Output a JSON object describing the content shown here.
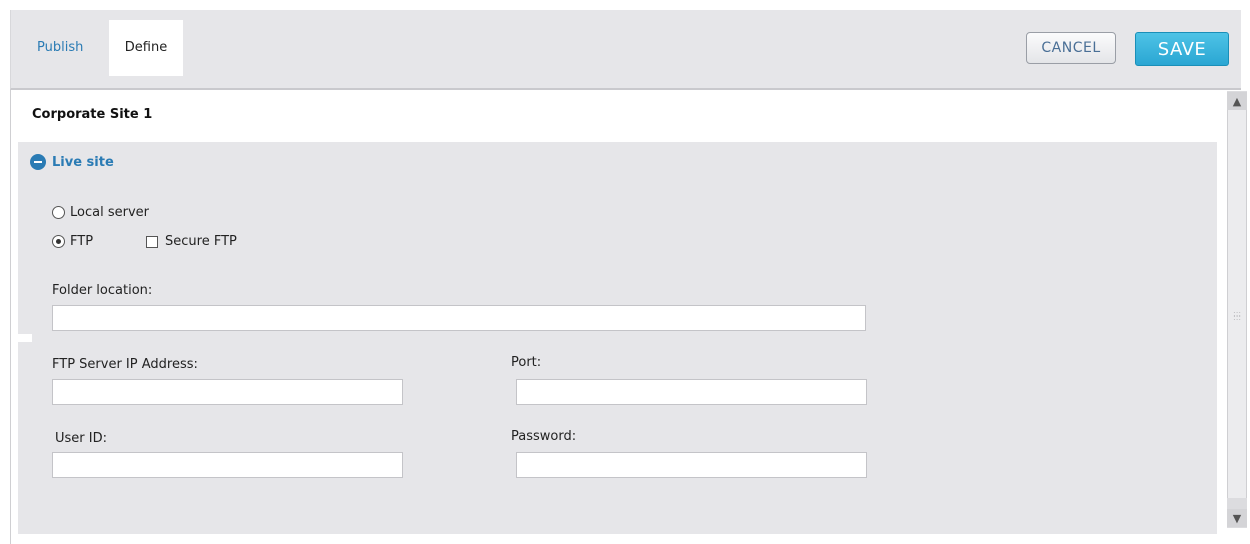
{
  "tabs": {
    "publish": "Publish",
    "define": "Define"
  },
  "buttons": {
    "cancel": "CANCEL",
    "save": "SAVE"
  },
  "site": {
    "title": "Corporate Site 1"
  },
  "section": {
    "title": "Live site",
    "options": {
      "local_server": "Local server",
      "ftp": "FTP",
      "secure_ftp": "Secure FTP",
      "selected": "FTP",
      "secure_ftp_checked": false
    },
    "fields": {
      "folder_location": {
        "label": "Folder location:",
        "value": ""
      },
      "ftp_server_ip": {
        "label": "FTP Server IP Address:",
        "value": ""
      },
      "port": {
        "label": "Port:",
        "value": ""
      },
      "user_id": {
        "label": "User ID:",
        "value": ""
      },
      "password": {
        "label": "Password:",
        "value": ""
      }
    }
  },
  "colors": {
    "accent": "#2a7bb4",
    "save_button": "#2aa6d3",
    "panel_bg": "#e6e6e9"
  },
  "icons": {
    "collapse": "minus-circle-icon",
    "scroll_up": "chevron-up-icon",
    "scroll_down": "chevron-down-icon"
  }
}
